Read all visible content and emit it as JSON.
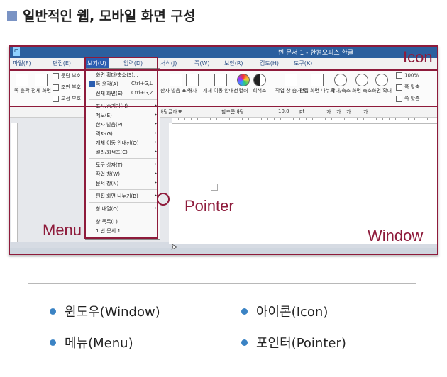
{
  "heading": "일반적인 웹, 모바일 화면 구성",
  "window": {
    "title": "빈 문서 1 - 한컴오피스 한글",
    "app_icon": "ㄷ"
  },
  "menubar": [
    "파일(F)",
    "편집(E)",
    "보기(U)",
    "입력(D)",
    "서식(J)",
    "쪽(W)",
    "보안(R)",
    "검토(H)",
    "도구(K)"
  ],
  "ribbon": {
    "left_buttons": [
      "쪽 윤곽",
      "전체 화면"
    ],
    "checks": [
      "문단 부호",
      "조판 부호",
      "교정 부호"
    ],
    "buttons": [
      "한자 발음 표시",
      "격자",
      "개체 이동 안내선",
      "컬러",
      "회색조",
      "작업 창 숨기기",
      "편집 화면 나누기",
      "확대/축소",
      "화면 축소",
      "화면 확대"
    ],
    "right_items": [
      "100%",
      "쪽 맞춤",
      "쪽 맞춤"
    ]
  },
  "toolbar2": {
    "style": "바탕글",
    "type": "대표",
    "font": "함초롬바탕",
    "size": "10.0",
    "unit": "pt",
    "format": [
      "가",
      "가",
      "가",
      "가"
    ]
  },
  "dropdown": {
    "items": [
      {
        "label": "화면 확대/축소(S)...",
        "key": ""
      },
      {
        "label": "쪽 윤곽(A)",
        "key": "Ctrl+G,L"
      },
      {
        "label": "전체 화면(E)",
        "key": "Ctrl+G,Z"
      },
      {
        "label": "표시/숨기기(H)",
        "key": ""
      },
      {
        "label": "메모(E)",
        "key": ""
      },
      {
        "label": "한자 발음(P)",
        "key": ""
      },
      {
        "label": "격자(G)",
        "key": ""
      },
      {
        "label": "개체 이동 안내선(Q)",
        "key": ""
      },
      {
        "label": "컬러/회색조(C)",
        "key": ""
      },
      {
        "label": "도구 상자(T)",
        "key": ""
      },
      {
        "label": "작업 창(W)",
        "key": ""
      },
      {
        "label": "문서 창(N)",
        "key": ""
      },
      {
        "label": "편집 화면 나누기(B)",
        "key": ""
      },
      {
        "label": "창 배열(O)",
        "key": ""
      },
      {
        "label": "창 목록(L)...",
        "key": ""
      },
      {
        "label": "1 빈 문서 1",
        "key": ""
      }
    ]
  },
  "annotations": {
    "icon": "Icon",
    "menu": "Menu",
    "pointer": "Pointer",
    "window": "Window"
  },
  "legend": [
    {
      "label": "윈도우(Window)"
    },
    {
      "label": "아이콘(Icon)"
    },
    {
      "label": "메뉴(Menu)"
    },
    {
      "label": "포인터(Pointer)"
    }
  ],
  "colors": {
    "annotation": "#8e1b3b",
    "bullet": "#3b83c4",
    "titlebar": "#2b5f9e"
  }
}
